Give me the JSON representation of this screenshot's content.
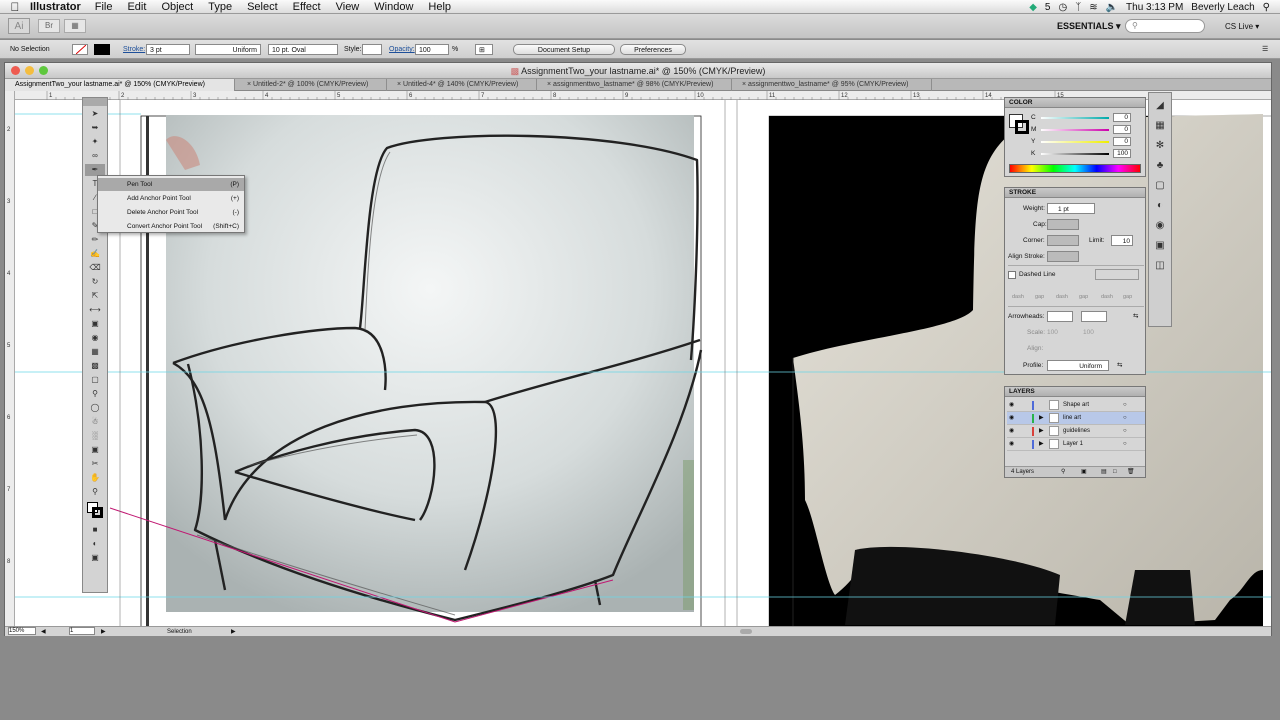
{
  "menubar": {
    "app_name": "Illustrator",
    "items": [
      "File",
      "Edit",
      "Object",
      "Type",
      "Select",
      "Effect",
      "View",
      "Window",
      "Help"
    ],
    "status": [
      "5",
      "Thu 3:13 PM",
      "Beverly Leach"
    ]
  },
  "appbar": {
    "logo": "Ai",
    "bridge": "Br",
    "workspace": "ESSENTIALS ▾",
    "search_placeholder": "",
    "cs_live": "CS Live ▾"
  },
  "controlbar": {
    "selection": "No Selection",
    "stroke_label": "Stroke:",
    "stroke_value": "3 pt",
    "profile": "Uniform",
    "brush": "10 pt. Oval",
    "style_label": "Style:",
    "opacity_label": "Opacity:",
    "opacity_value": "100",
    "percent": "%",
    "document_setup": "Document Setup",
    "preferences": "Preferences"
  },
  "window": {
    "title": "AssignmentTwo_your lastname.ai* @ 150% (CMYK/Preview)",
    "tabs": [
      "AssignmentTwo_your lastname.ai* @ 150% (CMYK/Preview)",
      "Untitled-2* @ 100% (CMYK/Preview)",
      "Untitled-4* @ 140% (CMYK/Preview)",
      "assignmenttwo_lastname* @ 98% (CMYK/Preview)",
      "assignmenttwo_lastname* @ 95% (CMYK/Preview)"
    ]
  },
  "statusbar": {
    "zoom": "150%",
    "page": "1",
    "status": "Selection"
  },
  "ruler": {
    "h_ticks": [
      "1",
      "2",
      "3",
      "4",
      "5",
      "6",
      "7",
      "8",
      "9",
      "10",
      "11",
      "12",
      "13",
      "14",
      "15"
    ],
    "v_ticks": [
      "2",
      "3",
      "4",
      "5",
      "6",
      "7",
      "8"
    ]
  },
  "flyout": {
    "items": [
      {
        "label": "Pen Tool",
        "shortcut": "(P)"
      },
      {
        "label": "Add Anchor Point Tool",
        "shortcut": "(+)"
      },
      {
        "label": "Delete Anchor Point Tool",
        "shortcut": "(-)"
      },
      {
        "label": "Convert Anchor Point Tool",
        "shortcut": "(Shift+C)"
      }
    ]
  },
  "color_panel": {
    "title": "COLOR",
    "channels": [
      {
        "name": "C",
        "value": "0"
      },
      {
        "name": "M",
        "value": "0"
      },
      {
        "name": "Y",
        "value": "0"
      },
      {
        "name": "K",
        "value": "100"
      }
    ]
  },
  "stroke_panel": {
    "title": "STROKE",
    "weight_label": "Weight:",
    "weight_value": "1 pt",
    "cap_label": "Cap:",
    "corner_label": "Corner:",
    "limit_label": "Limit:",
    "limit_value": "10",
    "align_label": "Align Stroke:",
    "dashed_label": "Dashed Line",
    "dash_labels": [
      "dash",
      "gap",
      "dash",
      "gap",
      "dash",
      "gap"
    ],
    "arrowheads_label": "Arrowheads:",
    "scale_label": "Scale:",
    "scale_values": [
      "100",
      "100"
    ],
    "align_arrow_label": "Align:",
    "profile_label": "Profile:",
    "profile_value": "Uniform"
  },
  "layers_panel": {
    "title": "LAYERS",
    "layers": [
      {
        "name": "Shape art",
        "color": "#4f6bd8"
      },
      {
        "name": "line art",
        "color": "#29b34a"
      },
      {
        "name": "guidelines",
        "color": "#d8403a"
      },
      {
        "name": "Layer 1",
        "color": "#4f6bd8"
      }
    ],
    "selected": "line art",
    "count": "4 Layers"
  }
}
